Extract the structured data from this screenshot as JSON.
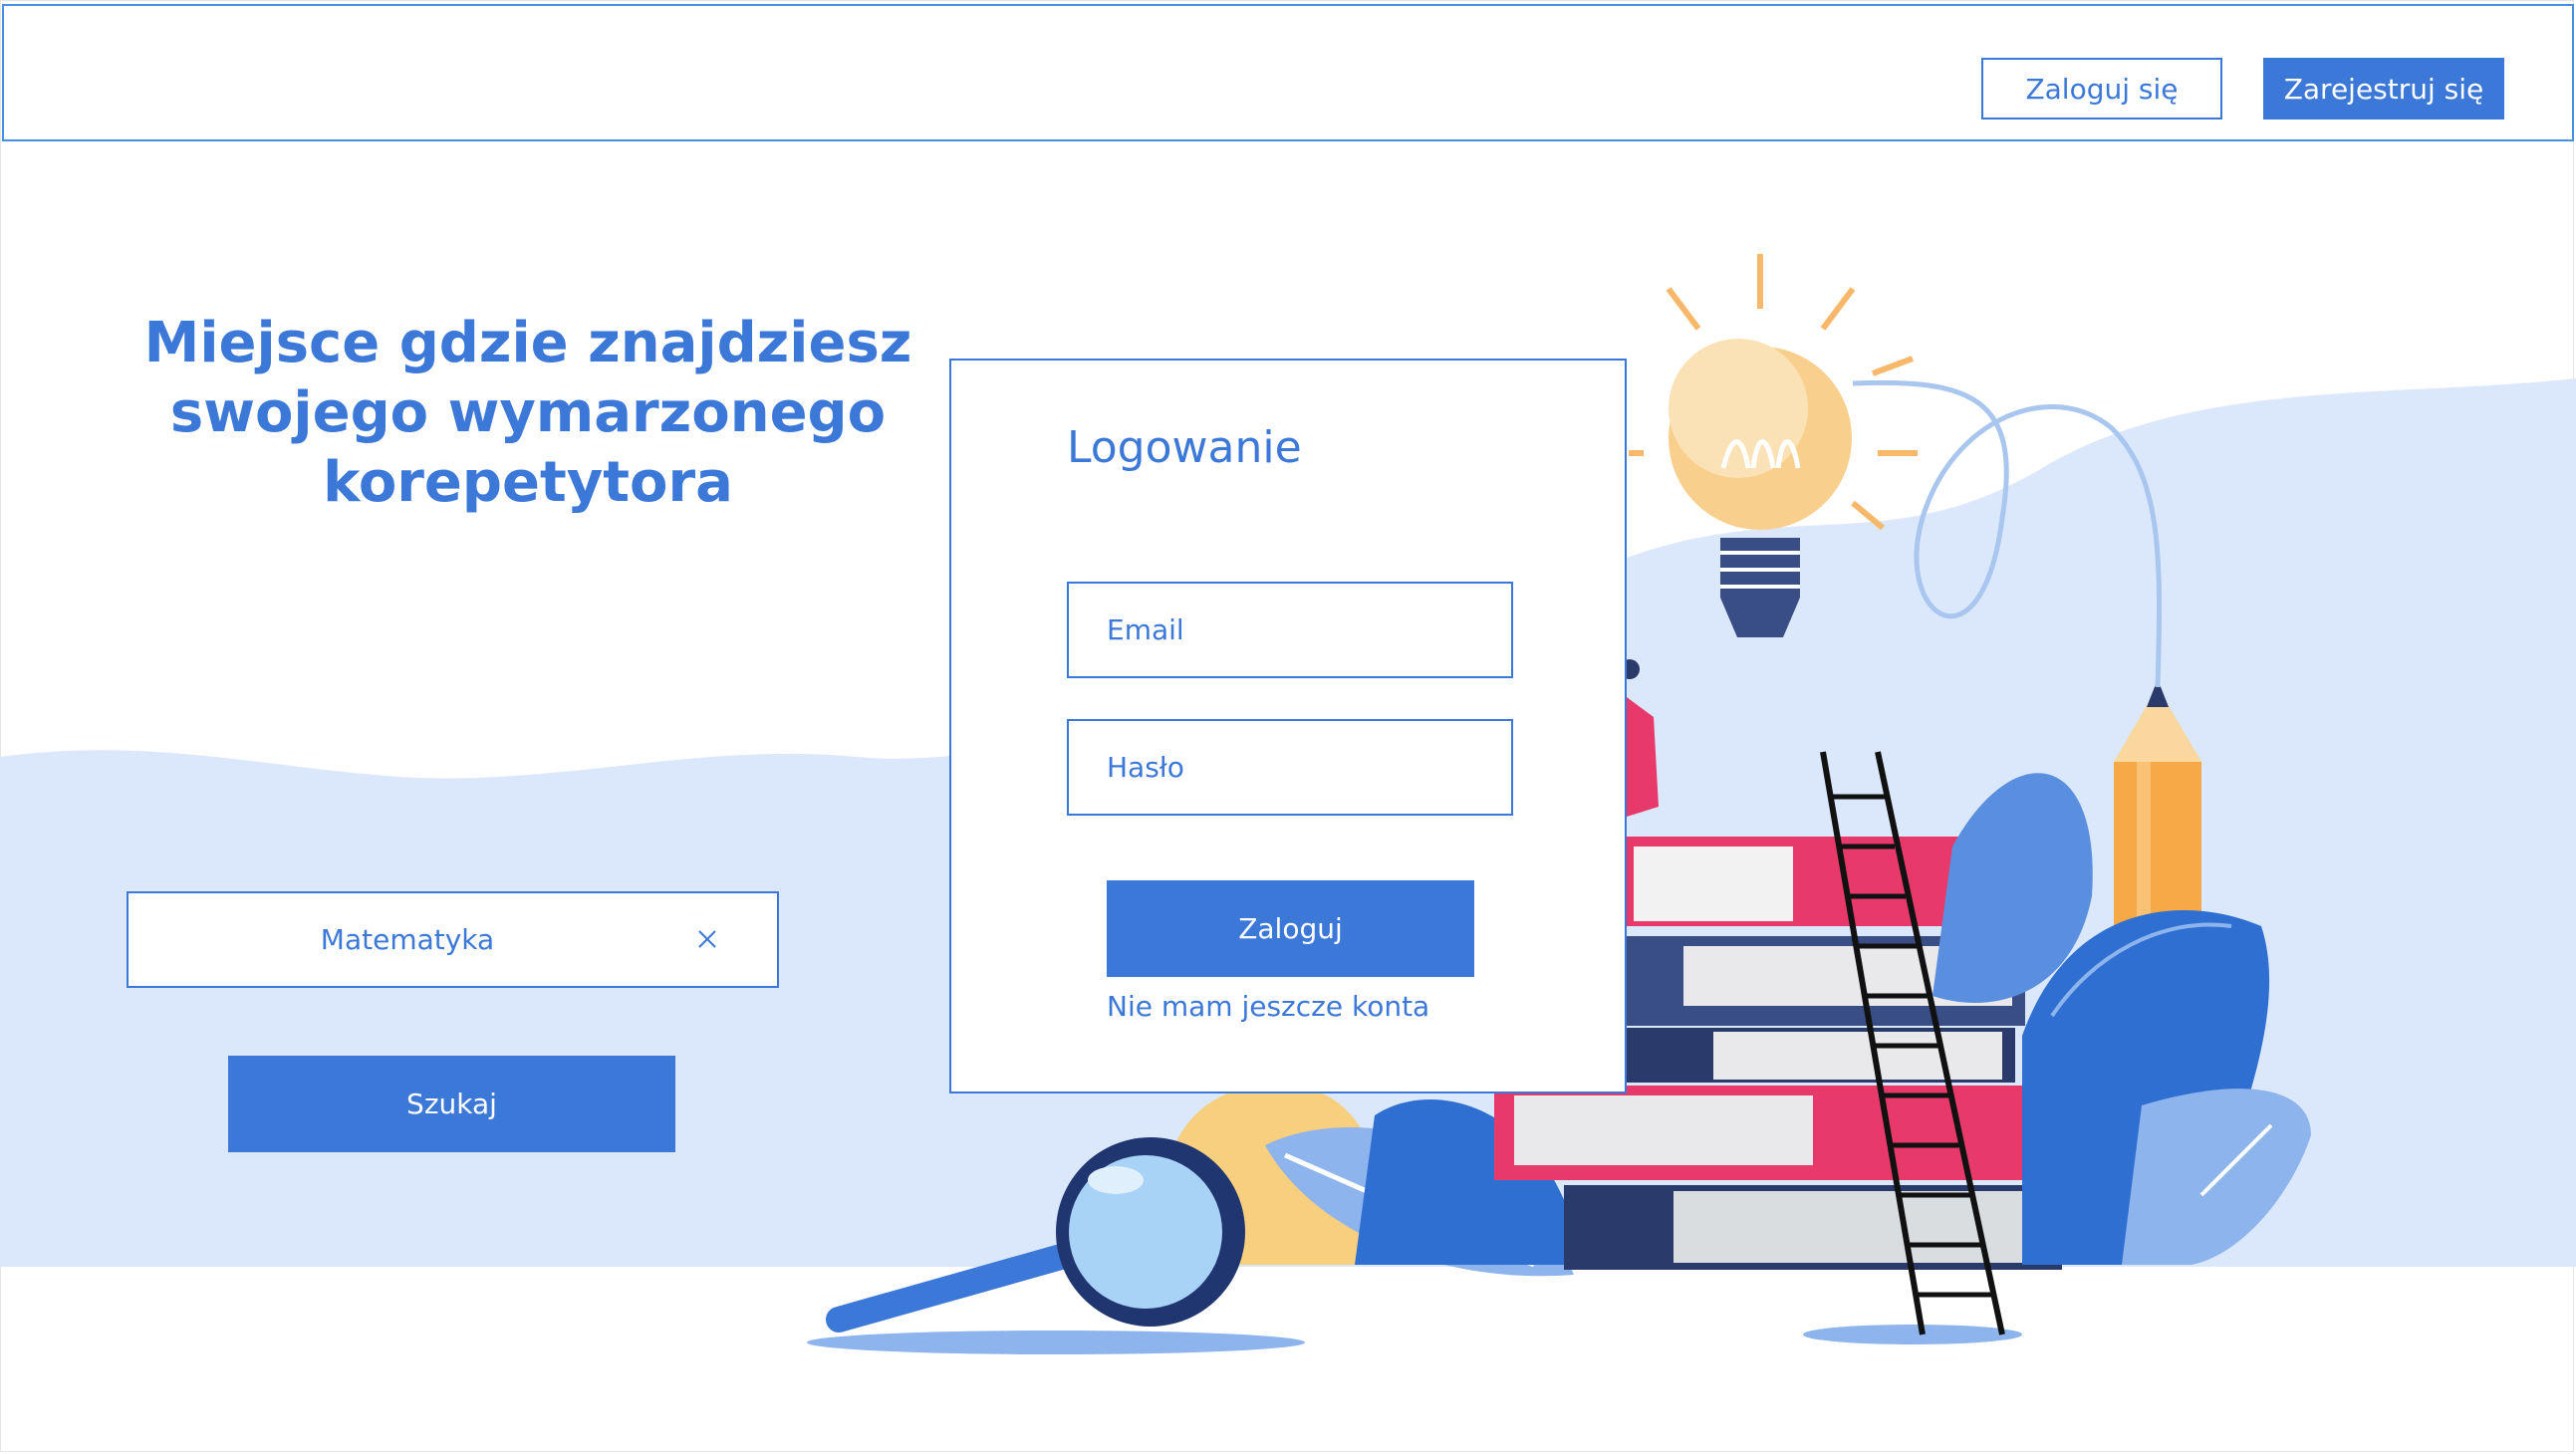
{
  "header": {
    "login_label": "Zaloguj się",
    "register_label": "Zarejestruj się"
  },
  "hero": {
    "headline_line1": "Miejsce gdzie znajdziesz",
    "headline_line2": "swojego wymarzonego",
    "headline_line3": "korepetytora"
  },
  "search": {
    "value": "Matematyka",
    "button_label": "Szukaj"
  },
  "login": {
    "title": "Logowanie",
    "email_placeholder": "Email",
    "password_placeholder": "Hasło",
    "submit_label": "Zaloguj",
    "no_account_link": "Nie mam jeszcze konta"
  },
  "icons": {
    "clear": "close-icon",
    "illustration": "books-lightbulb-illustration"
  },
  "colors": {
    "accent": "#3b78d8",
    "hero_bg": "#dbe8fc"
  }
}
